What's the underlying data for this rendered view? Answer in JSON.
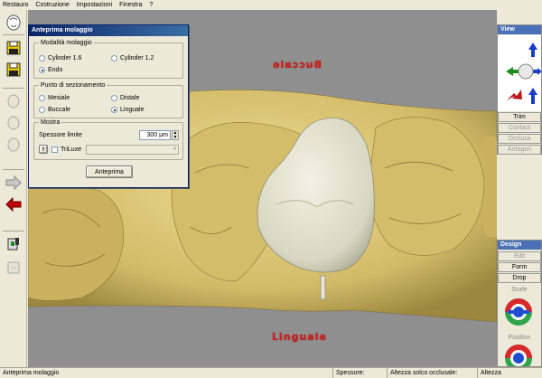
{
  "menu": [
    "Restauro",
    "Costruzione",
    "Impostazioni",
    "Finestra",
    "?"
  ],
  "dialog": {
    "title": "Anteprima molaggio",
    "grinding_mode": {
      "label": "Modalità molaggio",
      "options": [
        "Cylinder 1.6",
        "Cylinder 1.2",
        "Endo"
      ],
      "selected": "Endo"
    },
    "section_point": {
      "label": "Punto di sezionamento",
      "options": [
        "Mesiale",
        "Distale",
        "Buccale",
        "Linguale"
      ],
      "selected": "Linguale"
    },
    "show": {
      "label": "Mostra",
      "thickness_label": "Spessore limite",
      "thickness_value": "300 µm",
      "triluxe_label": "TriLuxe",
      "preview_button": "Anteprima"
    }
  },
  "viewport": {
    "label_top": "Buccale",
    "label_bottom": "Linguale"
  },
  "view_panel": {
    "title": "View",
    "buttons": [
      "Trim",
      "Contact",
      "Occlusa",
      "Antagon"
    ]
  },
  "design_panel": {
    "title": "Design",
    "buttons": [
      "Edit",
      "Form",
      "Drop"
    ],
    "section_labels": [
      "Scale",
      "Position"
    ]
  },
  "statusbar": {
    "left": "Anteprima molaggio",
    "thickness_label": "Spessore:",
    "groove_label": "Altezza solco occlusale:",
    "height_label": "Altezza"
  },
  "colors": {
    "selection_blue": "#0a246a",
    "panel_blue": "#4a70b8",
    "model_yellow": "#d9c376",
    "crown_ivory": "#e3e2cf",
    "label_red": "#d62020"
  }
}
